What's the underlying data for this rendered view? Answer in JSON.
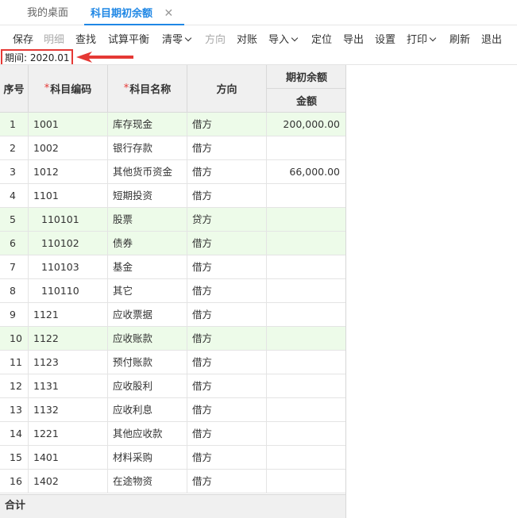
{
  "tabs": [
    {
      "label": "我的桌面",
      "active": false
    },
    {
      "label": "科目期初余额",
      "active": true
    }
  ],
  "toolbar": [
    {
      "label": "保存",
      "disabled": false,
      "dropdown": false
    },
    {
      "label": "明细",
      "disabled": true,
      "dropdown": false
    },
    {
      "label": "查找",
      "disabled": false,
      "dropdown": false
    },
    {
      "label": "试算平衡",
      "disabled": false,
      "dropdown": false
    },
    {
      "label": "清零",
      "disabled": false,
      "dropdown": true
    },
    {
      "label": "方向",
      "disabled": true,
      "dropdown": false
    },
    {
      "label": "对账",
      "disabled": false,
      "dropdown": false
    },
    {
      "label": "导入",
      "disabled": false,
      "dropdown": true
    },
    {
      "label": "定位",
      "disabled": false,
      "dropdown": false
    },
    {
      "label": "导出",
      "disabled": false,
      "dropdown": false
    },
    {
      "label": "设置",
      "disabled": false,
      "dropdown": false
    },
    {
      "label": "打印",
      "disabled": false,
      "dropdown": true
    },
    {
      "label": "刷新",
      "disabled": false,
      "dropdown": false
    },
    {
      "label": "退出",
      "disabled": false,
      "dropdown": false
    }
  ],
  "period": {
    "text": "期间: 2020.01"
  },
  "headers": {
    "seq": "序号",
    "code": "科目编码",
    "name": "科目名称",
    "direction": "方向",
    "opening_balance": "期初余额",
    "amount": "金额"
  },
  "rows": [
    {
      "seq": "1",
      "code": "1001",
      "name": "库存现金",
      "direction": "借方",
      "amount": "200,000.00",
      "highlight": true,
      "sub": false
    },
    {
      "seq": "2",
      "code": "1002",
      "name": "银行存款",
      "direction": "借方",
      "amount": "",
      "highlight": false,
      "sub": false
    },
    {
      "seq": "3",
      "code": "1012",
      "name": "其他货币资金",
      "direction": "借方",
      "amount": "66,000.00",
      "highlight": false,
      "sub": false
    },
    {
      "seq": "4",
      "code": "1101",
      "name": "短期投资",
      "direction": "借方",
      "amount": "",
      "highlight": false,
      "sub": false
    },
    {
      "seq": "5",
      "code": "110101",
      "name": "股票",
      "direction": "贷方",
      "amount": "",
      "highlight": true,
      "sub": true
    },
    {
      "seq": "6",
      "code": "110102",
      "name": "债券",
      "direction": "借方",
      "amount": "",
      "highlight": true,
      "sub": true
    },
    {
      "seq": "7",
      "code": "110103",
      "name": "基金",
      "direction": "借方",
      "amount": "",
      "highlight": false,
      "sub": true
    },
    {
      "seq": "8",
      "code": "110110",
      "name": "其它",
      "direction": "借方",
      "amount": "",
      "highlight": false,
      "sub": true
    },
    {
      "seq": "9",
      "code": "1121",
      "name": "应收票据",
      "direction": "借方",
      "amount": "",
      "highlight": false,
      "sub": false
    },
    {
      "seq": "10",
      "code": "1122",
      "name": "应收账款",
      "direction": "借方",
      "amount": "",
      "highlight": true,
      "sub": false
    },
    {
      "seq": "11",
      "code": "1123",
      "name": "预付账款",
      "direction": "借方",
      "amount": "",
      "highlight": false,
      "sub": false
    },
    {
      "seq": "12",
      "code": "1131",
      "name": "应收股利",
      "direction": "借方",
      "amount": "",
      "highlight": false,
      "sub": false
    },
    {
      "seq": "13",
      "code": "1132",
      "name": "应收利息",
      "direction": "借方",
      "amount": "",
      "highlight": false,
      "sub": false
    },
    {
      "seq": "14",
      "code": "1221",
      "name": "其他应收款",
      "direction": "借方",
      "amount": "",
      "highlight": false,
      "sub": false
    },
    {
      "seq": "15",
      "code": "1401",
      "name": "材料采购",
      "direction": "借方",
      "amount": "",
      "highlight": false,
      "sub": false
    },
    {
      "seq": "16",
      "code": "1402",
      "name": "在途物资",
      "direction": "借方",
      "amount": "",
      "highlight": false,
      "sub": false
    }
  ],
  "total": {
    "label": "合计"
  },
  "colors": {
    "accent": "#1f87e5",
    "highlight_row": "#edfbe9",
    "annotation": "#e53935"
  }
}
